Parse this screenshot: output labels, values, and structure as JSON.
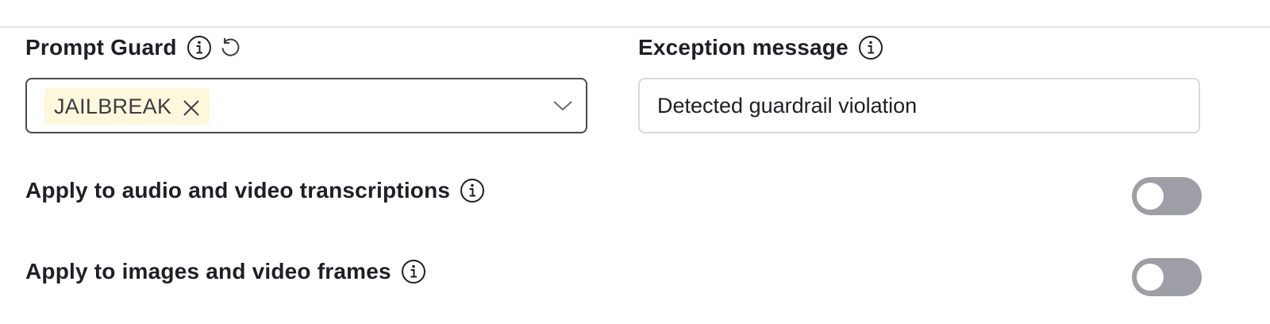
{
  "prompt_guard": {
    "label": "Prompt Guard",
    "selected_tags": [
      {
        "label": "JAILBREAK",
        "background": "#fdf7dc"
      }
    ]
  },
  "exception_message": {
    "label": "Exception message",
    "value": "Detected guardrail violation"
  },
  "options": [
    {
      "label": "Apply to audio and video transcriptions",
      "enabled": false
    },
    {
      "label": "Apply to images and video frames",
      "enabled": false
    }
  ],
  "icons": {
    "info": "info-icon",
    "reset": "reset-icon",
    "remove": "close-icon",
    "dropdown": "chevron-down-icon"
  },
  "colors": {
    "toggle_off": "#9e9ea6",
    "chip_background": "#fdf7dc",
    "select_border": "#4a4a52",
    "input_border": "#d9d9de"
  }
}
